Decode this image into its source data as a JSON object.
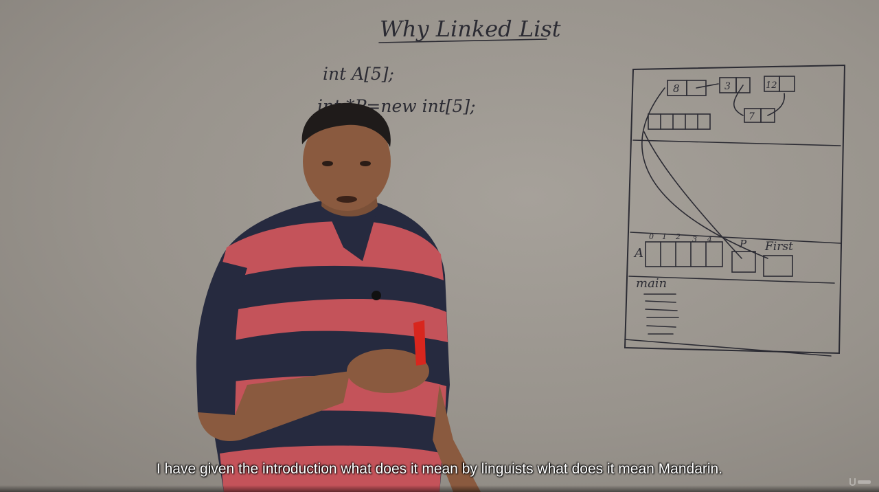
{
  "board": {
    "title": "Why Linked List",
    "code_line_1": "int A[5];",
    "code_line_2": "int *P=new int[5];",
    "diagram": {
      "heap_nodes": [
        "8",
        "3",
        "12",
        "7"
      ],
      "array_indices": [
        "0",
        "1",
        "2",
        "3",
        "4"
      ],
      "array_label": "A",
      "pointer_label_p": "P",
      "pointer_label_first": "First",
      "stack_frame_label": "main"
    }
  },
  "player": {
    "subtitle": "I have given the introduction what does it mean by linguists what does it mean Mandarin."
  },
  "colors": {
    "board": "#9c9791",
    "ink": "#2b2b33",
    "shirt_red": "#c4535a",
    "shirt_navy": "#262a3f",
    "marker": "#d8261e"
  }
}
